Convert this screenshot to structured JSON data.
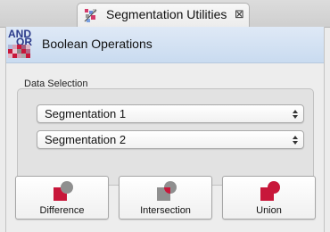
{
  "tab": {
    "title": "Segmentation Utilities",
    "close_glyph": "⊠",
    "icon": "segmentation-utilities-icon"
  },
  "header": {
    "title": "Boolean Operations",
    "logo_text_top": "AND",
    "logo_text_bottom": "OR"
  },
  "data_selection": {
    "label": "Data Selection",
    "selects": [
      {
        "value": "Segmentation 1"
      },
      {
        "value": "Segmentation 2"
      }
    ]
  },
  "buttons": {
    "difference": "Difference",
    "intersection": "Intersection",
    "union": "Union"
  },
  "colors": {
    "accent_red": "#c8173a",
    "shape_gray": "#8f8f8f",
    "header_blue": "#cfdff2",
    "logo_blue": "#2b3a8a"
  }
}
